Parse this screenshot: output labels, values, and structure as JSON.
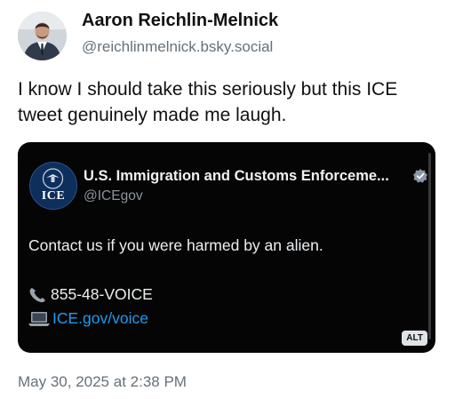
{
  "author": {
    "name": "Aaron Reichlin-Melnick",
    "handle": "@reichlinmelnick.bsky.social",
    "avatar_icon": "profile-photo"
  },
  "post": {
    "text": "I know I should take this seriously but this ICE tweet genuinely made me laugh.",
    "timestamp": "May 30, 2025 at 2:38 PM"
  },
  "embed": {
    "seal_text": "ICE",
    "name": "U.S. Immigration and Customs Enforceme...",
    "verified_icon": "verified-badge-icon",
    "handle": "@ICEgov",
    "body": "Contact us if you were harmed by an alien.",
    "phone": "855-48-VOICE",
    "link": "ICE.gov/voice",
    "alt_label": "ALT",
    "colors": {
      "background": "#050505",
      "link": "#1d9bf0",
      "seal": "#0e2f5c"
    }
  }
}
